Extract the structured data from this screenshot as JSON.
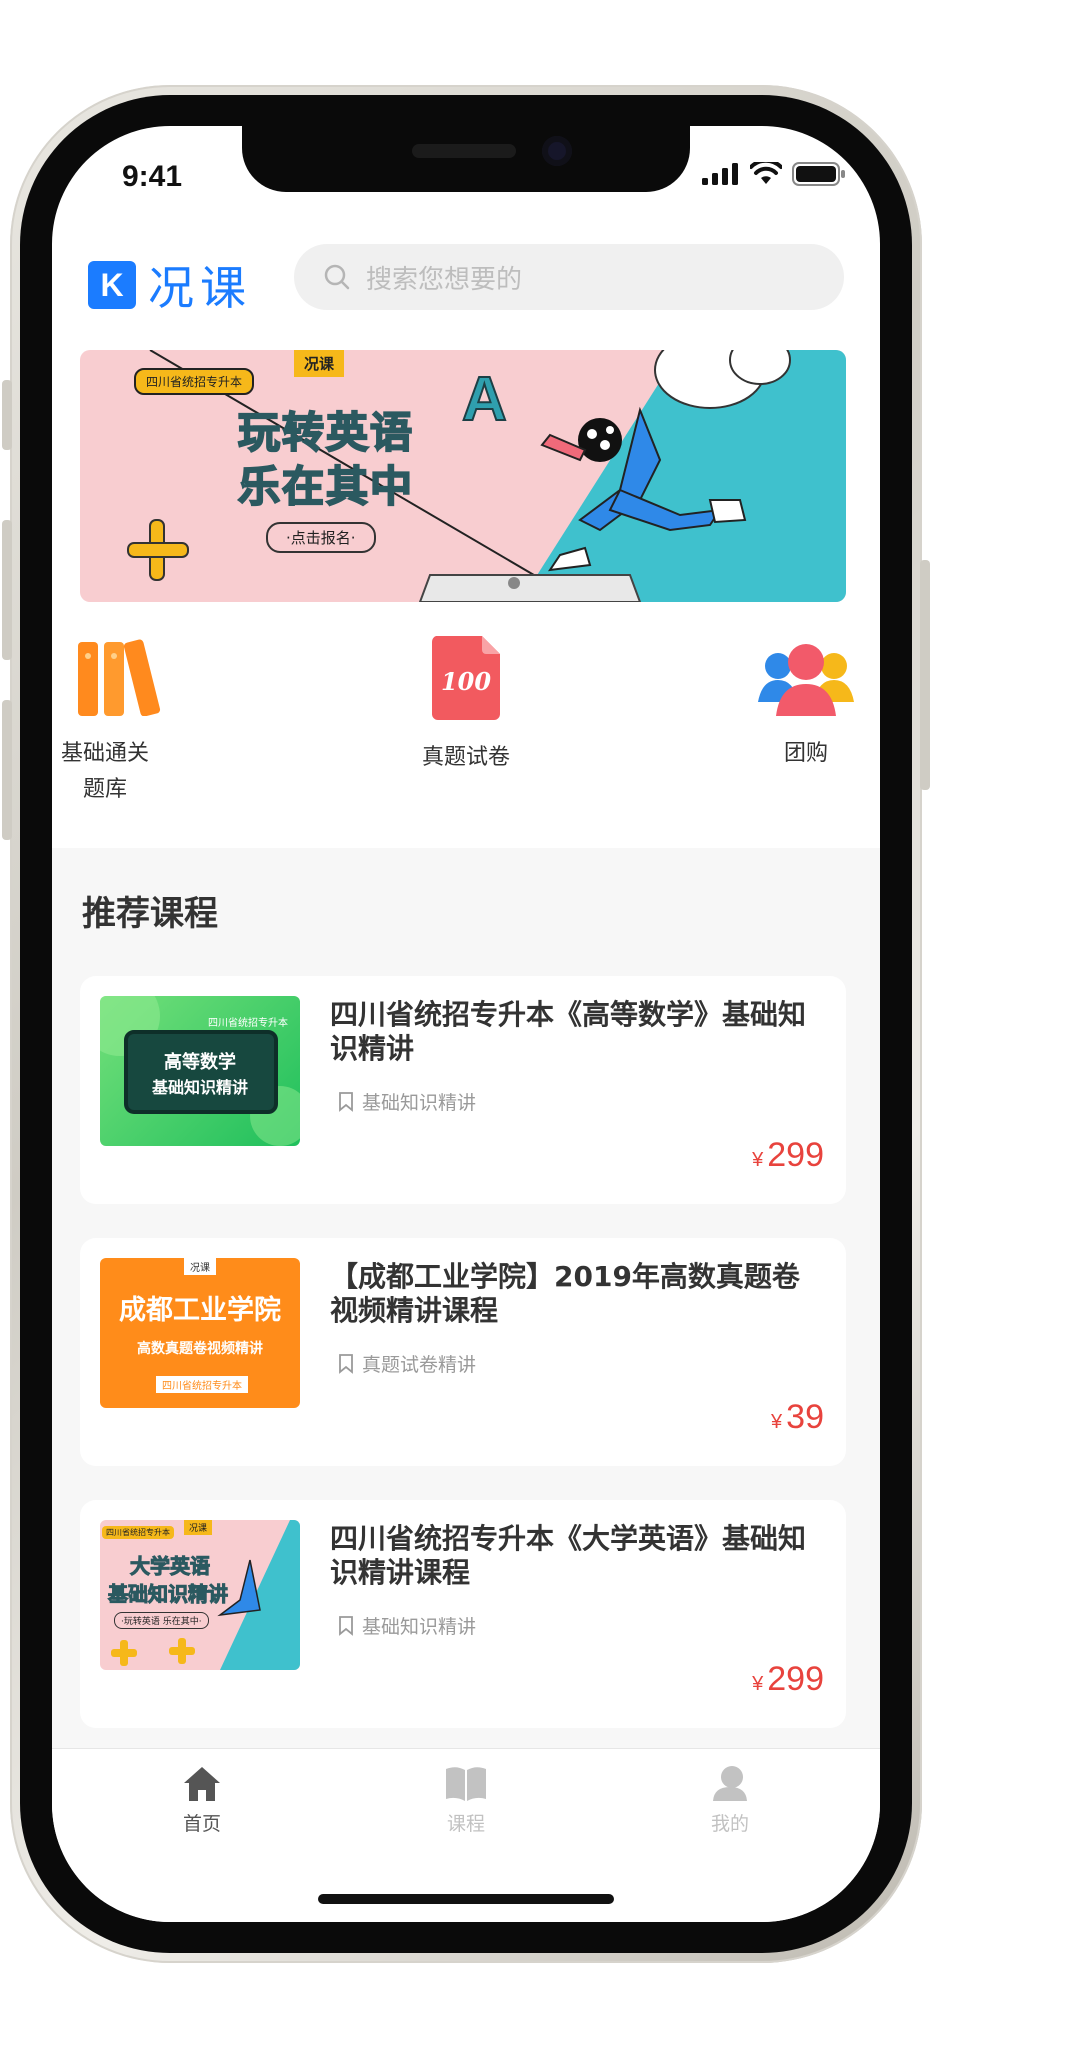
{
  "status_bar": {
    "time": "9:41"
  },
  "header": {
    "logo_badge": "K",
    "logo_text": "况课",
    "search_placeholder": "搜索您想要的"
  },
  "banner": {
    "tag": "四川省统招专升本",
    "brand": "况课",
    "title_line1": "玩转英语",
    "title_line2": "乐在其中",
    "cta": "·点击报名·"
  },
  "categories": [
    {
      "label": "基础通关\n题库",
      "icon": "books-icon"
    },
    {
      "label": "真题试卷",
      "icon": "exam-paper-icon"
    },
    {
      "label": "团购",
      "icon": "group-buy-icon"
    }
  ],
  "recommend": {
    "title": "推荐课程",
    "courses": [
      {
        "title": "四川省统招专升本《高等数学》基础知识精讲",
        "tag": "基础知识精讲",
        "price": "299",
        "currency": "¥",
        "thumb": {
          "header": "四川省统招专升本",
          "line1": "高等数学",
          "line2": "基础知识精讲"
        }
      },
      {
        "title": "【成都工业学院】2019年高数真题卷视频精讲课程",
        "tag": "真题试卷精讲",
        "price": "39",
        "currency": "¥",
        "thumb": {
          "brand": "况课",
          "line1": "成都工业学院",
          "line2": "高数真题卷视频精讲",
          "footer": "四川省统招专升本"
        }
      },
      {
        "title": "四川省统招专升本《大学英语》基础知识精讲课程",
        "tag": "基础知识精讲",
        "price": "299",
        "currency": "¥",
        "thumb": {
          "header": "四川省统招专升本",
          "brand": "况课",
          "line1": "大学英语",
          "line2": "基础知识精讲",
          "cta": "·玩转英语 乐在其中·"
        }
      }
    ]
  },
  "tabbar": {
    "items": [
      {
        "label": "首页",
        "icon": "home-icon",
        "active": true
      },
      {
        "label": "课程",
        "icon": "book-icon",
        "active": false
      },
      {
        "label": "我的",
        "icon": "user-icon",
        "active": false
      }
    ]
  },
  "colors": {
    "accent": "#1b7cff",
    "price": "#e8433d",
    "active_tab": "#555555",
    "inactive_tab": "#c2c2c2"
  }
}
